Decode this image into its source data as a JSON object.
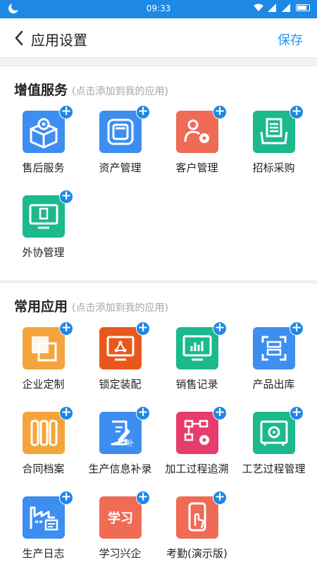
{
  "status": {
    "time": "09:33"
  },
  "header": {
    "title": "应用设置",
    "save_label": "保存"
  },
  "colors": {
    "accent": "#2196f3",
    "blue": "#3d8ef0",
    "orange": "#f5a43c",
    "red": "#ef6b56",
    "green": "#1bb98b",
    "deep_orange": "#e8581c",
    "pink": "#e73d6d"
  },
  "value_added": {
    "title": "增值服务",
    "hint": "(点击添加到我的应用)",
    "items": [
      {
        "label": "售后服务",
        "icon": "box-gear-icon"
      },
      {
        "label": "资产管理",
        "icon": "layers-icon"
      },
      {
        "label": "客户管理",
        "icon": "user-gear-icon"
      },
      {
        "label": "招标采购",
        "icon": "document-basket-icon"
      },
      {
        "label": "外协管理",
        "icon": "monitor-document-icon"
      }
    ]
  },
  "common": {
    "title": "常用应用",
    "hint": "(点击添加到我的应用)",
    "items": [
      {
        "label": "企业定制",
        "icon": "squares-icon"
      },
      {
        "label": "锁定装配",
        "icon": "screen-network-icon"
      },
      {
        "label": "销售记录",
        "icon": "monitor-chart-icon"
      },
      {
        "label": "产品出库",
        "icon": "scan-frame-icon"
      },
      {
        "label": "合同档案",
        "icon": "folders-icon"
      },
      {
        "label": "生产信息补录",
        "icon": "clipboard-pen-icon"
      },
      {
        "label": "加工过程追溯",
        "icon": "flow-gear-icon"
      },
      {
        "label": "工艺过程管理",
        "icon": "machine-gear-icon"
      },
      {
        "label": "生产日志",
        "icon": "factory-icon"
      },
      {
        "label": "学习兴企",
        "icon": "study-text-icon",
        "tile_text": "学习"
      },
      {
        "label": "考勤(演示版)",
        "icon": "phone-touch-icon"
      }
    ]
  }
}
